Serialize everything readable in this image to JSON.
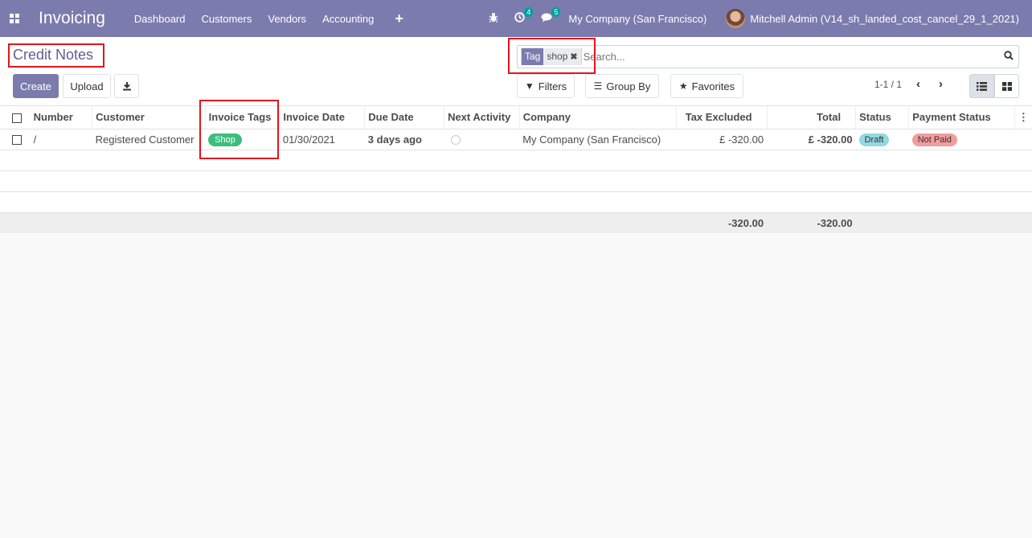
{
  "navbar": {
    "app_title": "Invoicing",
    "menu": [
      "Dashboard",
      "Customers",
      "Vendors",
      "Accounting"
    ],
    "plus_label": "+",
    "activity_count": "4",
    "messages_count": "5",
    "company": "My Company (San Francisco)",
    "user": "Mitchell Admin (V14_sh_landed_cost_cancel_29_1_2021)"
  },
  "control_panel": {
    "title": "Credit Notes",
    "search": {
      "facet_label": "Tag",
      "facet_value": "shop",
      "placeholder": "Search..."
    },
    "buttons": {
      "create": "Create",
      "upload": "Upload",
      "filters": "Filters",
      "group_by": "Group By",
      "favorites": "Favorites"
    },
    "pager": "1-1 / 1"
  },
  "table": {
    "headers": [
      "Number",
      "Customer",
      "Invoice Tags",
      "Invoice Date",
      "Due Date",
      "Next Activity",
      "Company",
      "Tax Excluded",
      "Total",
      "Status",
      "Payment Status"
    ],
    "rows": [
      {
        "number": "/",
        "customer": "Registered Customer",
        "tag": "Shop",
        "invoice_date": "01/30/2021",
        "due_date": "3 days ago",
        "company": "My Company (San Francisco)",
        "tax_excluded": "£ -320.00",
        "total": "£ -320.00",
        "status": "Draft",
        "payment_status": "Not Paid"
      }
    ],
    "footer": {
      "tax_excluded": "-320.00",
      "total": "-320.00"
    }
  },
  "colors": {
    "brand": "#7c7bad",
    "tag_green": "#3dbd7d",
    "late_red": "#d23f3a",
    "highlight": "#e0161c"
  }
}
